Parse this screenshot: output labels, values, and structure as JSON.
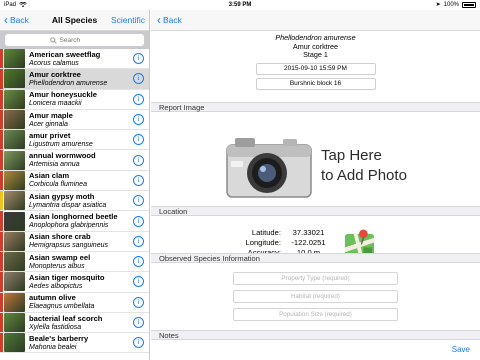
{
  "status": {
    "carrier": "iPad",
    "time": "3:59 PM",
    "battery": "100%"
  },
  "left": {
    "back_label": "Back",
    "title": "All Species",
    "right_label": "Scientific",
    "search_placeholder": "Search",
    "items": [
      {
        "common": "American sweetflag",
        "scientific": "Acorus calamus",
        "stripe": "#d33b2c",
        "thumb": "#5d8a3a"
      },
      {
        "common": "Amur corktree",
        "scientific": "Phellodendron amurense",
        "stripe": "#d33b2c",
        "thumb": "#4f7a2c"
      },
      {
        "common": "Amur honeysuckle",
        "scientific": "Lonicera maackii",
        "stripe": "#d33b2c",
        "thumb": "#6a8f45"
      },
      {
        "common": "Amur maple",
        "scientific": "Acer ginnala",
        "stripe": "#d33b2c",
        "thumb": "#8a6a4a"
      },
      {
        "common": "amur privet",
        "scientific": "Ligustrum amurense",
        "stripe": "#d33b2c",
        "thumb": "#6b8a55"
      },
      {
        "common": "annual wormwood",
        "scientific": "Artemisia annua",
        "stripe": "#d33b2c",
        "thumb": "#7f9b5e"
      },
      {
        "common": "Asian clam",
        "scientific": "Corbicula fluminea",
        "stripe": "#d33b2c",
        "thumb": "#b08a3c"
      },
      {
        "common": "Asian gypsy moth",
        "scientific": "Lymantria dispar asiatica",
        "stripe": "#f2c21a",
        "thumb": "#a68d6a"
      },
      {
        "common": "Asian longhorned beetle",
        "scientific": "Anoplophora glabripennis",
        "stripe": "#d33b2c",
        "thumb": "#3a3a3a"
      },
      {
        "common": "Asian shore crab",
        "scientific": "Hemigrapsus sanguineus",
        "stripe": "#d33b2c",
        "thumb": "#9a7b62"
      },
      {
        "common": "Asian swamp eel",
        "scientific": "Monopterus albus",
        "stripe": "#d33b2c",
        "thumb": "#6f6a4a"
      },
      {
        "common": "Asian tiger mosquito",
        "scientific": "Aedes albopictus",
        "stripe": "#d33b2c",
        "thumb": "#8d7e6c"
      },
      {
        "common": "autumn olive",
        "scientific": "Elaeagnus umbellata",
        "stripe": "#d33b2c",
        "thumb": "#c1763a"
      },
      {
        "common": "bacterial leaf scorch",
        "scientific": "Xylella fastidiosa",
        "stripe": "#d33b2c",
        "thumb": "#5f8a3e"
      },
      {
        "common": "Beale's barberry",
        "scientific": "Mahonia bealei",
        "stripe": "#d33b2c",
        "thumb": "#4c7a3a"
      }
    ]
  },
  "right": {
    "back_label": "Back",
    "scientific": "Phellodendron amurense",
    "common": "Amur corktree",
    "stage": "Stage 1",
    "datetime": "2015-09-10 15:59 PM",
    "location_name": "Burshnic block 16",
    "report_image_header": "Report Image",
    "photo_text_line1": "Tap Here",
    "photo_text_line2": "to Add Photo",
    "location_header": "Location",
    "latitude_label": "Latitude:",
    "latitude_value": "37.33021",
    "longitude_label": "Longitude:",
    "longitude_value": "-122.0251",
    "accuracy_label": "Accuracy:",
    "accuracy_value": "10.0 m",
    "observed_header": "Observed Species Information",
    "property_placeholder": "Property Type (required)",
    "habitat_placeholder": "Habitat (required)",
    "population_placeholder": "Population Size (required)",
    "notes_header": "Notes",
    "save_label": "Save"
  },
  "colors": {
    "accent": "#1a7cf5",
    "section_bg": "#efeff4",
    "selected_row": "#d9d9d9"
  }
}
